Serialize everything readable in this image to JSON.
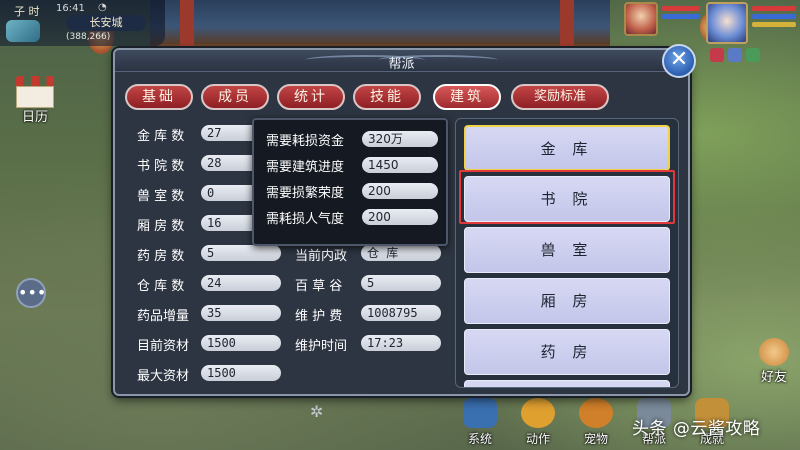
{
  "hud": {
    "hour": "子 时",
    "clock": "16:41",
    "city": "长安城",
    "coords": "(388,266)"
  },
  "side": {
    "calendar_label": "日历",
    "chat_glyph": "•••",
    "friend_label": "好友"
  },
  "bottom_bar": [
    {
      "label": "系统",
      "icon": "monitor-icon",
      "color": "#3a6fb0"
    },
    {
      "label": "动作",
      "icon": "smile-icon",
      "color": "#e0a030"
    },
    {
      "label": "宠物",
      "icon": "tiger-icon",
      "color": "#d0802a"
    },
    {
      "label": "帮派",
      "icon": "flag-icon",
      "color": "#7a8a9a"
    },
    {
      "label": "成就",
      "icon": "trophy-icon",
      "color": "#c29038"
    }
  ],
  "watermark": "头条 @云酱攻略",
  "dialog": {
    "title": "帮派",
    "close_glyph": "✕",
    "tabs": [
      {
        "label": "基础",
        "active": false
      },
      {
        "label": "成员",
        "active": false
      },
      {
        "label": "统计",
        "active": false
      },
      {
        "label": "技能",
        "active": false
      },
      {
        "label": "建筑",
        "active": true
      },
      {
        "label": "奖励标准",
        "active": false
      }
    ],
    "stats_left": [
      {
        "label": "金 库 数",
        "value": "27"
      },
      {
        "label": "书 院 数",
        "value": "28"
      },
      {
        "label": "兽 室 数",
        "value": "0"
      },
      {
        "label": "厢 房 数",
        "value": "16"
      },
      {
        "label": "药 房 数",
        "value": "5"
      },
      {
        "label": "仓 库 数",
        "value": "24"
      },
      {
        "label": "药品增量",
        "value": "35"
      },
      {
        "label": "目前资材",
        "value": "1500"
      },
      {
        "label": "最大资材",
        "value": "1500"
      }
    ],
    "stats_right": [
      {
        "label": "当前内政",
        "value": "仓 库"
      },
      {
        "label": "百 草 谷",
        "value": "5"
      },
      {
        "label": "维 护 费",
        "value": "1008795"
      },
      {
        "label": "维护时间",
        "value": "17:23"
      }
    ],
    "tooltip": [
      {
        "label": "需要耗损资金",
        "value": "320万"
      },
      {
        "label": "需要建筑进度",
        "value": "1450"
      },
      {
        "label": "需要损繁荣度",
        "value": "200"
      },
      {
        "label": "需耗损人气度",
        "value": "200"
      }
    ],
    "buildings": [
      {
        "label": "金 库",
        "state": "selected"
      },
      {
        "label": "书 院",
        "state": "highlighted"
      },
      {
        "label": "兽 室",
        "state": "normal"
      },
      {
        "label": "厢 房",
        "state": "normal"
      },
      {
        "label": "药 房",
        "state": "normal"
      }
    ]
  }
}
